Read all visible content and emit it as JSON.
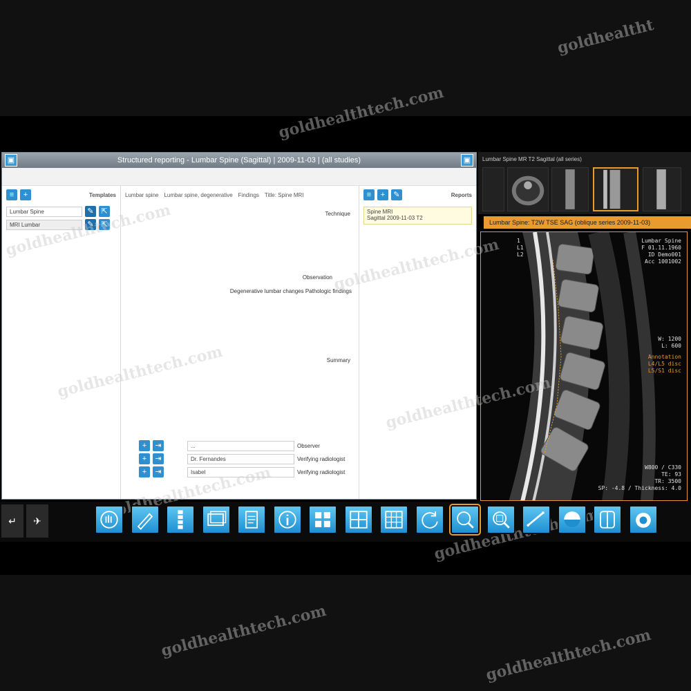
{
  "watermark": "goldhealthtech.com",
  "watermark_short": "goldhealtht",
  "report_window": {
    "title": "Structured reporting - Lumbar Spine (Sagittal) | 2009-11-03 | (all studies)",
    "templates_label": "Templates",
    "template_items": [
      "Lumbar Spine",
      "MRI Lumbar"
    ],
    "tabs": [
      "Lumbar spine",
      "Lumbar spine, degenerative",
      "Findings",
      "Title: Spine MRI"
    ],
    "sections": {
      "technique": "Technique",
      "observation": "Observation",
      "observation_text": "Degenerative lumbar changes  Pathologic findings",
      "summary": "Summary"
    },
    "form_rows": [
      {
        "label": "Observer",
        "value": "..."
      },
      {
        "label": "Verifying radiologist",
        "value": "Dr. Fernandes"
      },
      {
        "label": "Verifying radiologist",
        "value": "Isabel"
      }
    ],
    "reports_label": "Reports",
    "report_entry": "Spine MRI",
    "report_entry_sub": "Sagittal 2009-11-03 T2"
  },
  "viewer": {
    "thumb_header": "Lumbar Spine   MR T2 Sagittal   (all series)",
    "orange_bar": "Lumbar Spine: T2W TSE SAG (oblique series 2009-11-03)",
    "overlay_top_left": "1\nL1\nL2",
    "overlay_top_right": "Lumbar Spine\nF 01.11.1960\nID Demo001\nAcc 1001002",
    "overlay_mid_right": "W: 1200\nL: 600",
    "overlay_orange": "Annotation\nL4/L5 disc\nL5/S1 disc",
    "overlay_bottom_right": "W800 / C330\nTE: 93\nTR: 3500\nSP: -4.8 / Thickness: 4.0"
  },
  "toolbar": {
    "icons": [
      "hand-icon",
      "pencil-icon",
      "spine-icon",
      "image-stack-icon",
      "document-icon",
      "info-icon",
      "grid-2x2-icon",
      "layout-4-icon",
      "layout-9-icon",
      "rotate-icon",
      "zoom-icon",
      "zoom-region-icon",
      "measure-icon",
      "contrast-icon",
      "window-level-icon",
      "camera-icon"
    ],
    "left_buttons": [
      "↵",
      "✈"
    ]
  },
  "colors": {
    "accent": "#e89b2e",
    "button_blue": "#2f8fcf",
    "background": "#0e0e0e"
  }
}
